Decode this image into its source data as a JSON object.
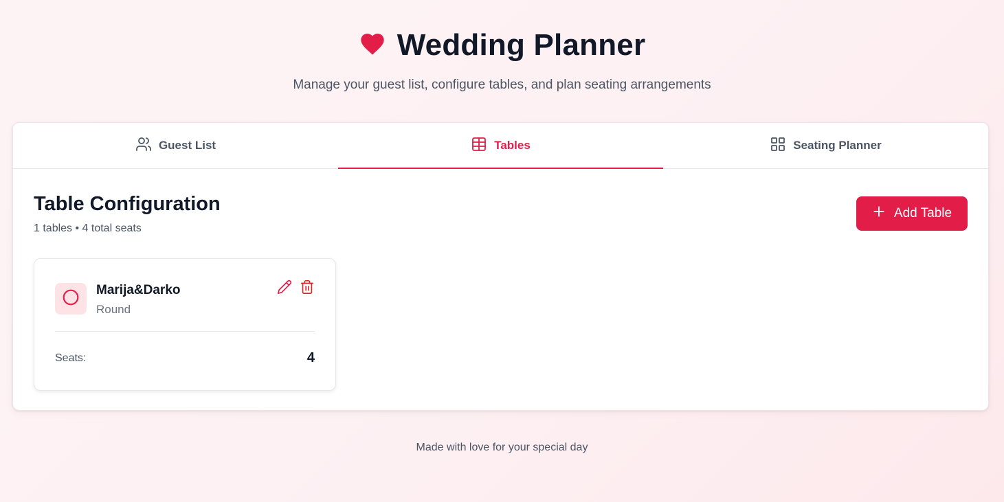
{
  "header": {
    "icon": "heart-icon",
    "title": "Wedding Planner",
    "subtitle": "Manage your guest list, configure tables, and plan seating arrangements"
  },
  "tabs": [
    {
      "label": "Guest List",
      "icon": "users-icon",
      "active": false
    },
    {
      "label": "Tables",
      "icon": "table-grid-icon",
      "active": true
    },
    {
      "label": "Seating Planner",
      "icon": "layout-grid-icon",
      "active": false
    }
  ],
  "section": {
    "title": "Table Configuration",
    "meta": "1 tables • 4 total seats",
    "add_button_label": "Add Table"
  },
  "tables_list": [
    {
      "name": "Marija&Darko",
      "shape": "Round",
      "seats_label": "Seats:",
      "seats": "4"
    }
  ],
  "footer": {
    "text": "Made with love for your special day"
  },
  "colors": {
    "accent": "#e11d48",
    "badge_bg": "#fde2e6",
    "text_primary": "#111827",
    "text_secondary": "#4b5563"
  }
}
